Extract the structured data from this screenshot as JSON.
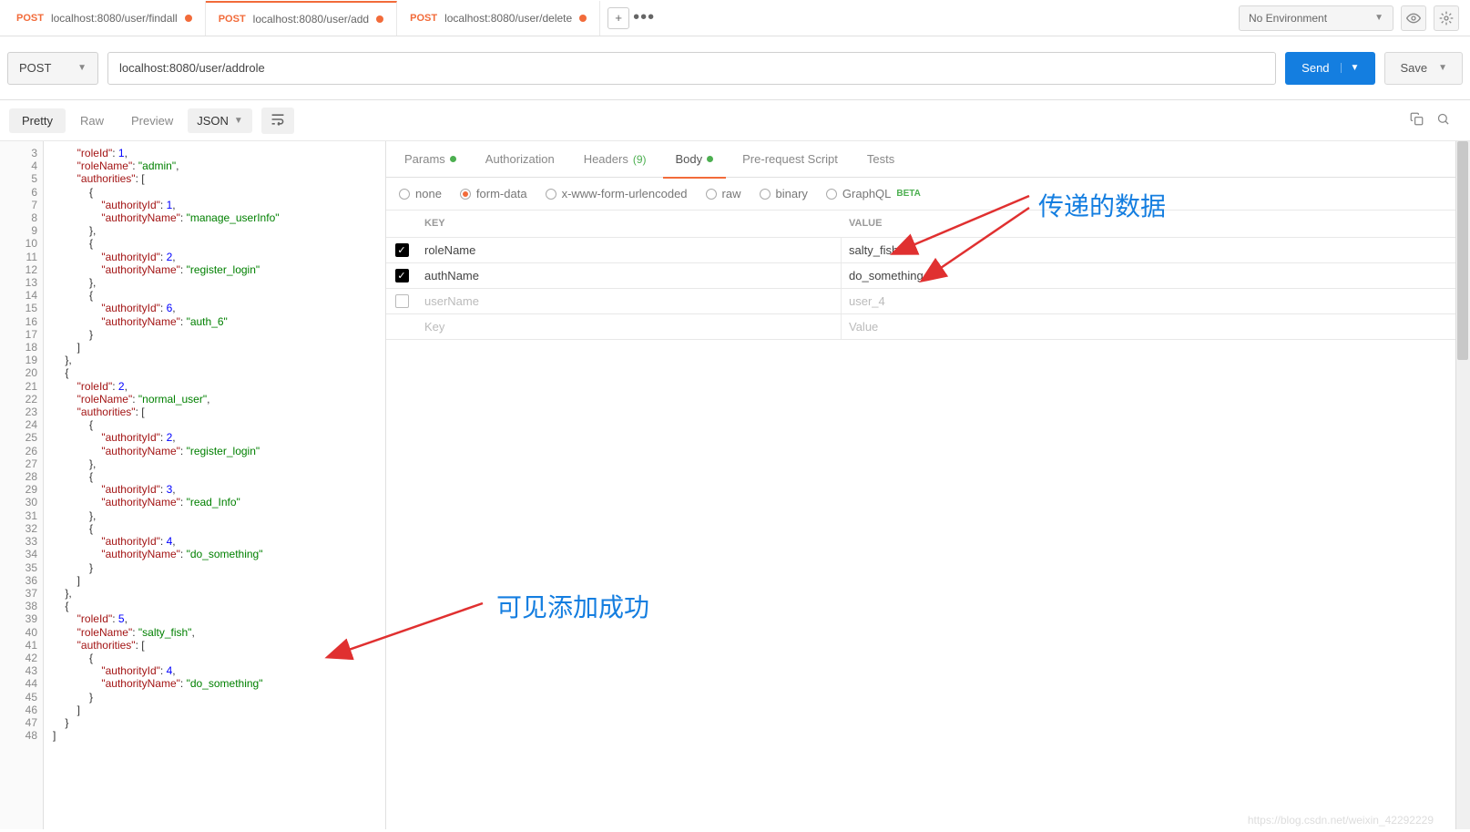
{
  "env": {
    "label": "No Environment"
  },
  "tabs": [
    {
      "method": "POST",
      "url": "localhost:8080/user/findall"
    },
    {
      "method": "POST",
      "url": "localhost:8080/user/add"
    },
    {
      "method": "POST",
      "url": "localhost:8080/user/delete"
    }
  ],
  "request": {
    "method": "POST",
    "url": "localhost:8080/user/addrole",
    "send": "Send",
    "save": "Save"
  },
  "viewbar": {
    "pretty": "Pretty",
    "raw": "Raw",
    "preview": "Preview",
    "format": "JSON"
  },
  "reqtabs": {
    "params": "Params",
    "auth": "Authorization",
    "headers": "Headers",
    "headers_count": "(9)",
    "body": "Body",
    "prereq": "Pre-request Script",
    "tests": "Tests"
  },
  "bodytypes": {
    "none": "none",
    "formdata": "form-data",
    "xwww": "x-www-form-urlencoded",
    "raw": "raw",
    "binary": "binary",
    "graphql": "GraphQL",
    "beta": "BETA"
  },
  "kv": {
    "key_h": "KEY",
    "val_h": "VALUE",
    "rows": [
      {
        "checked": true,
        "key": "roleName",
        "val": "salty_fish"
      },
      {
        "checked": true,
        "key": "authName",
        "val": "do_something"
      },
      {
        "checked": false,
        "key": "userName",
        "val": "user_4"
      }
    ],
    "ph_key": "Key",
    "ph_val": "Value"
  },
  "anno": {
    "top": "传递的数据",
    "bottom": "可见添加成功"
  },
  "lines": {
    "3": "        <span class='tok-k'>\"roleId\"</span><span class='tok-p'>: </span><span class='tok-n'>1</span><span class='tok-p'>,</span>",
    "4": "        <span class='tok-k'>\"roleName\"</span><span class='tok-p'>: </span><span class='tok-s'>\"admin\"</span><span class='tok-p'>,</span>",
    "5": "        <span class='tok-k'>\"authorities\"</span><span class='tok-p'>: [</span>",
    "6": "            <span class='tok-p'>{</span>",
    "7": "                <span class='tok-k'>\"authorityId\"</span><span class='tok-p'>: </span><span class='tok-n'>1</span><span class='tok-p'>,</span>",
    "8": "                <span class='tok-k'>\"authorityName\"</span><span class='tok-p'>: </span><span class='tok-s'>\"manage_userInfo\"</span>",
    "9": "            <span class='tok-p'>},</span>",
    "10": "            <span class='tok-p'>{</span>",
    "11": "                <span class='tok-k'>\"authorityId\"</span><span class='tok-p'>: </span><span class='tok-n'>2</span><span class='tok-p'>,</span>",
    "12": "                <span class='tok-k'>\"authorityName\"</span><span class='tok-p'>: </span><span class='tok-s'>\"register_login\"</span>",
    "13": "            <span class='tok-p'>},</span>",
    "14": "            <span class='tok-p'>{</span>",
    "15": "                <span class='tok-k'>\"authorityId\"</span><span class='tok-p'>: </span><span class='tok-n'>6</span><span class='tok-p'>,</span>",
    "16": "                <span class='tok-k'>\"authorityName\"</span><span class='tok-p'>: </span><span class='tok-s'>\"auth_6\"</span>",
    "17": "            <span class='tok-p'>}</span>",
    "18": "        <span class='tok-p'>]</span>",
    "19": "    <span class='tok-p'>},</span>",
    "20": "    <span class='tok-p'>{</span>",
    "21": "        <span class='tok-k'>\"roleId\"</span><span class='tok-p'>: </span><span class='tok-n'>2</span><span class='tok-p'>,</span>",
    "22": "        <span class='tok-k'>\"roleName\"</span><span class='tok-p'>: </span><span class='tok-s'>\"normal_user\"</span><span class='tok-p'>,</span>",
    "23": "        <span class='tok-k'>\"authorities\"</span><span class='tok-p'>: [</span>",
    "24": "            <span class='tok-p'>{</span>",
    "25": "                <span class='tok-k'>\"authorityId\"</span><span class='tok-p'>: </span><span class='tok-n'>2</span><span class='tok-p'>,</span>",
    "26": "                <span class='tok-k'>\"authorityName\"</span><span class='tok-p'>: </span><span class='tok-s'>\"register_login\"</span>",
    "27": "            <span class='tok-p'>},</span>",
    "28": "            <span class='tok-p'>{</span>",
    "29": "                <span class='tok-k'>\"authorityId\"</span><span class='tok-p'>: </span><span class='tok-n'>3</span><span class='tok-p'>,</span>",
    "30": "                <span class='tok-k'>\"authorityName\"</span><span class='tok-p'>: </span><span class='tok-s'>\"read_Info\"</span>",
    "31": "            <span class='tok-p'>},</span>",
    "32": "            <span class='tok-p'>{</span>",
    "33": "                <span class='tok-k'>\"authorityId\"</span><span class='tok-p'>: </span><span class='tok-n'>4</span><span class='tok-p'>,</span>",
    "34": "                <span class='tok-k'>\"authorityName\"</span><span class='tok-p'>: </span><span class='tok-s'>\"do_something\"</span>",
    "35": "            <span class='tok-p'>}</span>",
    "36": "        <span class='tok-p'>]</span>",
    "37": "    <span class='tok-p'>},</span>",
    "38": "    <span class='tok-p'>{</span>",
    "39": "        <span class='tok-k'>\"roleId\"</span><span class='tok-p'>: </span><span class='tok-n'>5</span><span class='tok-p'>,</span>",
    "40": "        <span class='tok-k'>\"roleName\"</span><span class='tok-p'>: </span><span class='tok-s'>\"salty_fish\"</span><span class='tok-p'>,</span>",
    "41": "        <span class='tok-k'>\"authorities\"</span><span class='tok-p'>: [</span>",
    "42": "            <span class='tok-p'>{</span>",
    "43": "                <span class='tok-k'>\"authorityId\"</span><span class='tok-p'>: </span><span class='tok-n'>4</span><span class='tok-p'>,</span>",
    "44": "                <span class='tok-k'>\"authorityName\"</span><span class='tok-p'>: </span><span class='tok-s'>\"do_something\"</span>",
    "45": "            <span class='tok-p'>}</span>",
    "46": "        <span class='tok-p'>]</span>",
    "47": "    <span class='tok-p'>}</span>",
    "48": "<span class='tok-p'>]</span>"
  },
  "watermark": "https://blog.csdn.net/weixin_42292229"
}
